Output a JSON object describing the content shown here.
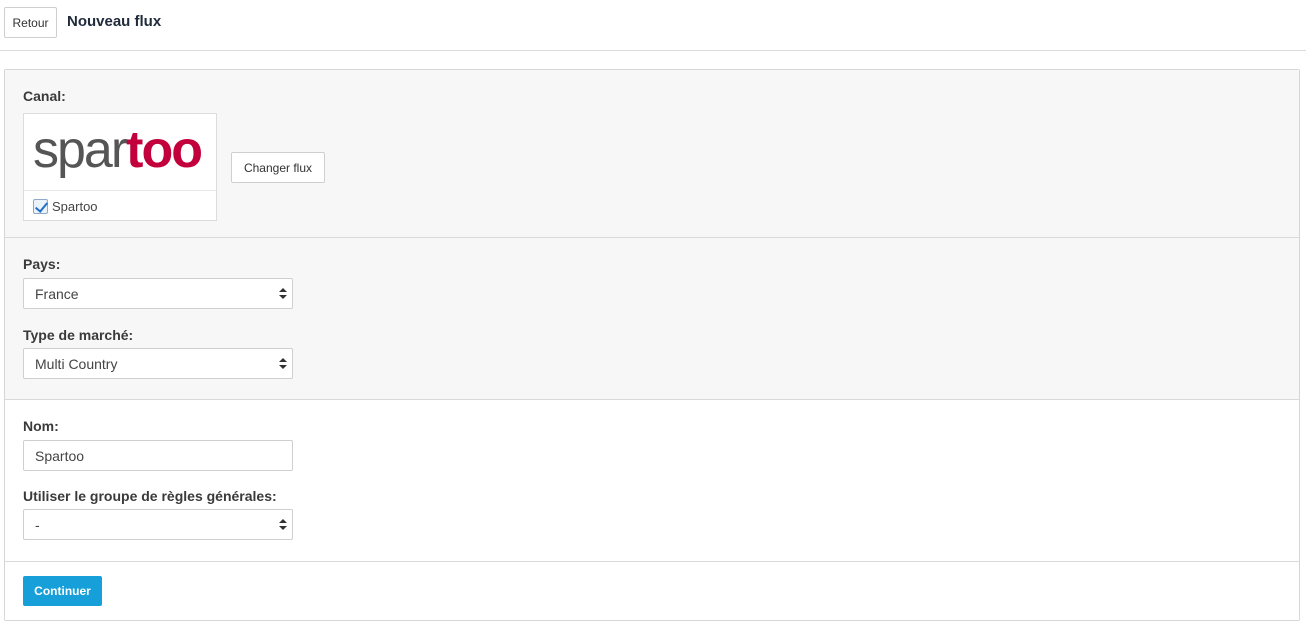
{
  "header": {
    "back_label": "Retour",
    "title": "Nouveau flux"
  },
  "canal": {
    "label": "Canal:",
    "logo": {
      "part1": "spar",
      "part2": "too"
    },
    "channel_name": "Spartoo",
    "checked": true,
    "change_label": "Changer flux",
    "brand_colors": {
      "spar": "#555555",
      "too": "#c2003b"
    }
  },
  "pays": {
    "label": "Pays:",
    "value": "France"
  },
  "market": {
    "label": "Type de marché:",
    "value": "Multi Country"
  },
  "nom": {
    "label": "Nom:",
    "value": "Spartoo"
  },
  "rules": {
    "label": "Utiliser le groupe de règles générales:",
    "value": "-"
  },
  "actions": {
    "continue_label": "Continuer",
    "accent_color": "#169fd8"
  }
}
